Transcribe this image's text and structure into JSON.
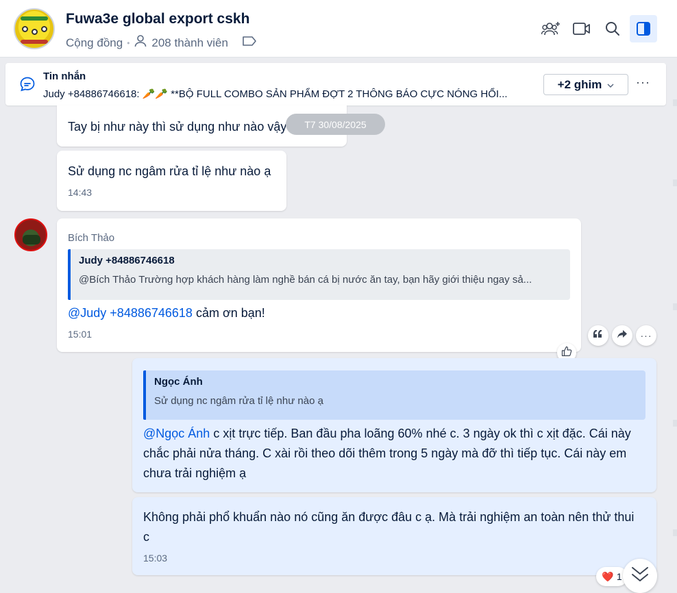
{
  "header": {
    "title": "Fuwa3e global export cskh",
    "community_label": "Cộng đồng",
    "members": "208 thành viên",
    "icons": [
      "add-member-icon",
      "video-call-icon",
      "search-icon",
      "sidebar-toggle-icon",
      "person-icon",
      "tag-icon"
    ]
  },
  "pinned": {
    "title": "Tin nhắn",
    "text": "Judy +84886746618: 🥕🥕 **BỘ FULL COMBO SẢN PHẨM ĐỢT 2  THÔNG BÁO CỰC NÓNG HỔI...",
    "more_label": "+2 ghim",
    "menu_label": "···"
  },
  "date_divider": "T7 30/08/2025",
  "messages": [
    {
      "text": "Tay bị như này thì sử dụng như nào vậy",
      "time": ""
    },
    {
      "text": "Sử dụng nc ngâm rửa tỉ lệ như nào ạ",
      "time": "14:43"
    },
    {
      "sender": "Bích Thảo",
      "quote_author": "Judy +84886746618",
      "quote_text": "@Bích Thảo Trường hợp khách hàng làm nghề bán cá bị nước ăn tay, bạn hãy giới thiệu ngay sả...",
      "mention": "@Judy +84886746618",
      "text": " cảm ơn bạn!",
      "time": "15:01"
    },
    {
      "quote_author": "Ngọc Ánh",
      "quote_text": "Sử dụng nc ngâm rửa tỉ lệ như nào ạ",
      "mention": "@Ngọc Ánh",
      "text": " c xịt trực tiếp. Ban đầu pha loãng 60% nhé c. 3 ngày ok thì c xịt đặc. Cái này chắc phải nửa tháng. C xài rồi theo dõi thêm trong 5 ngày mà đỡ thì tiếp tục. Cái này em chưa trải nghiệm ạ",
      "time": ""
    },
    {
      "text": "Không phải phổ khuẩn nào nó cũng ăn được đâu c ạ. Mà trải nghiệm an toàn nên thử thui c",
      "time": "15:03"
    }
  ],
  "reaction": {
    "emoji": "❤️",
    "count": "1"
  }
}
